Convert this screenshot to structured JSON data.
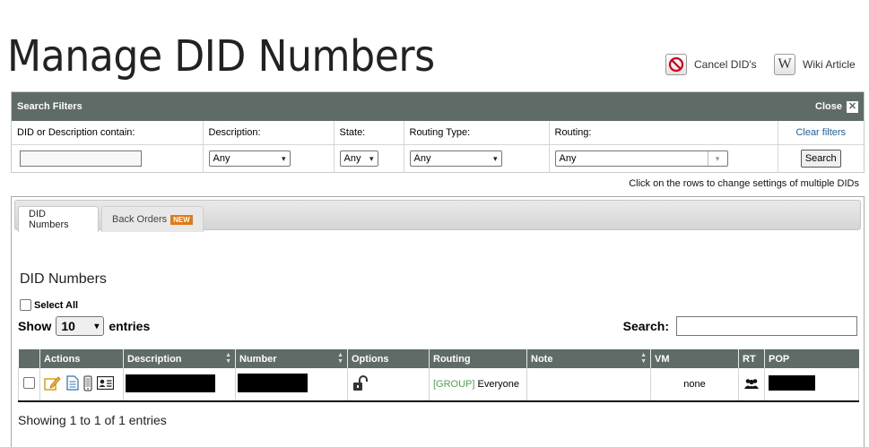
{
  "page": {
    "title": "Manage DID Numbers"
  },
  "top_actions": {
    "cancel_dids": "Cancel DID's",
    "wiki_article": "Wiki Article"
  },
  "filters": {
    "heading": "Search Filters",
    "close_label": "Close",
    "columns": {
      "did_or_desc": "DID or Description contain:",
      "description": "Description:",
      "state": "State:",
      "routing_type": "Routing Type:",
      "routing": "Routing:"
    },
    "clear_label": "Clear filters",
    "description_value": "Any",
    "state_value": "Any",
    "routing_type_value": "Any",
    "routing_value": "Any",
    "search_button": "Search"
  },
  "hint": "Click on the rows to change settings of multiple DIDs",
  "tabs": [
    {
      "label": "DID Numbers"
    },
    {
      "label": "Back Orders",
      "badge": "NEW"
    }
  ],
  "section": {
    "title": "DID Numbers",
    "select_all": "Select All",
    "show_label": "Show",
    "page_size": "10",
    "entries_label": "entries",
    "search_label": "Search:"
  },
  "table": {
    "columns": [
      "Actions",
      "Description",
      "Number",
      "Options",
      "Routing",
      "Note",
      "VM",
      "RT",
      "POP"
    ],
    "rows": [
      {
        "routing_group": "[GROUP]",
        "routing_target": "Everyone",
        "vm": "none"
      }
    ],
    "info": "Showing 1 to 1 of 1 entries"
  },
  "colors": {
    "header_bg": "#5f6b67",
    "accent_orange": "#e07a16",
    "group_green": "#4aa84a"
  },
  "icons": [
    "cancel-icon",
    "wiki-icon",
    "close-icon",
    "edit-icon",
    "document-icon",
    "phone-icon",
    "vcard-icon",
    "unlock-icon",
    "group-icon",
    "sort-icon",
    "chevron-down-icon"
  ]
}
